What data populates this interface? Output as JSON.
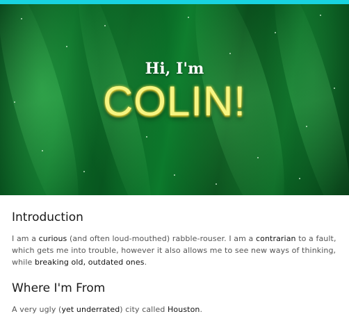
{
  "hero": {
    "greeting": "Hi, I'm",
    "name": "COLIN!"
  },
  "sections": [
    {
      "heading": "Introduction",
      "paragraph_parts": [
        "I am a ",
        "curious",
        " (and often loud-mouthed) rabble-rouser. I am a ",
        "contrarian",
        " to a fault, which gets me into trouble, however it also allows me to see new ways of thinking, while ",
        "breaking old, outdated ones",
        "."
      ]
    },
    {
      "heading": "Where I'm From",
      "paragraph_parts": [
        "A very ugly (",
        "yet underrated",
        ") city called ",
        "Houston",
        "."
      ]
    }
  ],
  "colors": {
    "top_bar": "#18d3e0",
    "hero_dark_green": "#063d17",
    "name_yellow": "#f6f582",
    "heading_text": "#1a1a1a",
    "body_text": "#555555"
  }
}
